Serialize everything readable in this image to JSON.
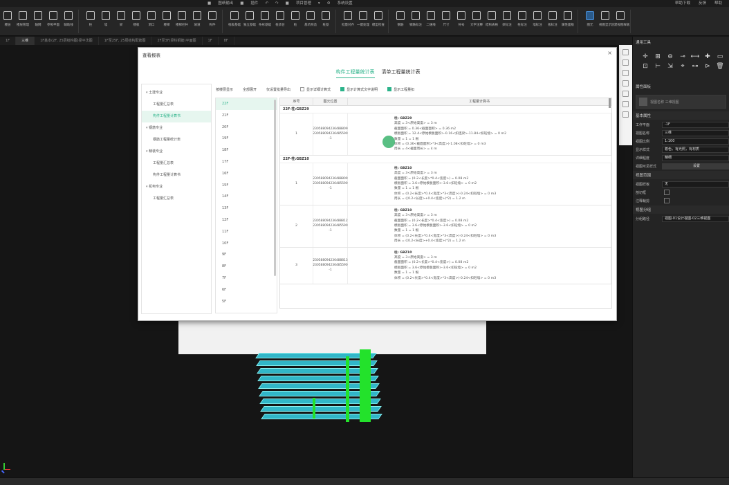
{
  "titlebar": {
    "menu": [
      "■",
      "图纸输出",
      "■",
      "插件",
      "↶",
      "↷",
      "■",
      "项目管理",
      "▾",
      "⚙",
      "系统设置"
    ],
    "right": [
      "帮助下载",
      "反馈",
      "帮助"
    ]
  },
  "ribbon": {
    "groups": [
      [
        "楼层",
        "楼层管理",
        "轴网",
        "参照平面",
        "辅助线"
      ],
      [
        "柱",
        "墙",
        "梁",
        "楼板",
        "洞口",
        "楼梯",
        "楼梯栏杆",
        "坡道",
        "构件"
      ],
      [
        "筏板基础",
        "独立基础",
        "条形基础",
        "桩承台",
        "桩",
        "基坑构造",
        "桩基"
      ],
      [
        "批量对齐",
        "一键处理",
        "模型检查"
      ],
      [
        "钢筋",
        "钢筋标注",
        "二维线",
        "尺寸",
        "符号",
        "文字注释",
        "结构表格",
        "梁标注",
        "柱标注",
        "墙标注",
        "板标注",
        "属性面板"
      ],
      [
        "图元",
        "视图显示",
        "创建视图样板"
      ]
    ]
  },
  "doctabs": [
    "1F",
    "三维",
    "1F基本(2F, 25层结构图)梁平法图",
    "1F至25F, 25层结构配筋图",
    "2F至3F(梁柱钢筋)平面图",
    "1F",
    "8F"
  ],
  "dialog": {
    "title": "查看报表",
    "close": "×",
    "tabs": [
      "构件工程量统计表",
      "清单工程量统计表"
    ],
    "tree": [
      {
        "label": "土建专业",
        "level": 0
      },
      {
        "label": "工程量汇总表",
        "level": 1
      },
      {
        "label": "构件工程量计算书",
        "level": 1,
        "selected": true
      },
      {
        "label": "钢筋专业",
        "level": 0
      },
      {
        "label": "钢筋工程量统计表",
        "level": 1
      },
      {
        "label": "精装专业",
        "level": 0
      },
      {
        "label": "工程量汇总表",
        "level": 1
      },
      {
        "label": "构件工程量计算书",
        "level": 1
      },
      {
        "label": "机电专业",
        "level": 0
      },
      {
        "label": "工程量汇总表",
        "level": 1
      }
    ],
    "toolbar": {
      "layer_display": "按楼层显示",
      "expand_all": "全部展开",
      "export": "仅设置批量导出",
      "show_detail": "显示详细计算式",
      "show_formula_text": "显示计算式文字说明",
      "show_qty_unit": "显示工程量扣"
    },
    "floors": [
      "22F",
      "21F",
      "20F",
      "19F",
      "18F",
      "17F",
      "16F",
      "15F",
      "14F",
      "13F",
      "12F",
      "11F",
      "10F",
      "9F",
      "8F",
      "7F",
      "6F",
      "5F"
    ],
    "table": {
      "headers": [
        "序号",
        "图元位置",
        "工程量计算书"
      ],
      "groups": [
        {
          "title": "22F-柱:GBZ29",
          "rows": [
            {
              "idx": "1",
              "pos": [
                "230588094236488809",
                "230588094236485590",
                "-1"
              ],
              "calc": [
                "柱: GBZ29",
                "高度 = 3<原始高度> = 3 m",
                "截面面积 = 0.36<截面面积> = 0.36 m2",
                "模板面积 = 12.4<原始模板面积>-0.16<扣连梁>-11.84<扣砼墙> = 0 m2",
                "数量 = 1 = 1 根",
                "体积 = (0.36<截面面积>*3<高度>)-1.08<扣砼墙> = 0 m3",
                "周长 = 4<截面周长> = 4 m"
              ]
            }
          ]
        },
        {
          "title": "22F-柱:GBZ10",
          "rows": [
            {
              "idx": "1",
              "pos": [
                "230588094236488809",
                "230588094236485590",
                "-1"
              ],
              "calc": [
                "柱: GBZ10",
                "高度 = 3<原始高度> = 3 m",
                "截面面积 = (0.2<长度>*0.4<宽度>) = 0.08 m2",
                "模板面积 = 3.6<原始模板面积>-3.6<扣砼墙> = 0 m2",
                "数量 = 1 = 1 根",
                "体积 = (0.2<长度>*0.4<宽度>*3<高度>)-0.24<扣砼墙> = 0 m3",
                "周长 = ((0.2<长度>+0.4<宽度>)*2) = 1.2 m"
              ]
            },
            {
              "idx": "2",
              "pos": [
                "230588094236488812",
                "230588094236485590",
                "-1"
              ],
              "calc": [
                "柱: GBZ10",
                "高度 = 3<原始高度> = 3 m",
                "截面面积 = (0.2<长度>*0.4<宽度>) = 0.08 m2",
                "模板面积 = 3.6<原始模板面积>-3.6<扣砼墙> = 0 m2",
                "数量 = 1 = 1 根",
                "体积 = (0.2<长度>*0.4<宽度>*3<高度>)-0.24<扣砼墙> = 0 m3",
                "周长 = ((0.2<长度>+0.4<宽度>)*2) = 1.2 m"
              ]
            },
            {
              "idx": "3",
              "pos": [
                "230588094236488813",
                "230588094236485590",
                "-1"
              ],
              "calc": [
                "柱: GBZ10",
                "高度 = 3<原始高度> = 3 m",
                "截面面积 = (0.2<长度>*0.4<宽度>) = 0.08 m2",
                "模板面积 = 3.6<原始模板面积>-3.6<扣砼墙> = 0 m2",
                "数量 = 1 = 1 根",
                "体积 = (0.2<长度>*0.4<宽度>*3<高度>)-0.24<扣砼墙> = 0 m3"
              ]
            }
          ]
        }
      ]
    }
  },
  "rightpanel": {
    "title": "通用工具",
    "tools": [
      "✛",
      "⊞",
      "⊖",
      "⊸",
      "⟷",
      "✚",
      "▭",
      "⊡",
      "⊢",
      "⇲",
      "⌖",
      "⊶",
      "⊳",
      "🗑"
    ],
    "props_title": "属性面板",
    "preview_label": "视图名称 三维视图",
    "section_basic": "基本属性",
    "props": [
      {
        "k": "工作平面",
        "v": "-1F"
      },
      {
        "k": "视图名称",
        "v": "三维"
      },
      {
        "k": "视图比例",
        "v": "1:100"
      },
      {
        "k": "显示样式",
        "v": "着色，有光照，有材质"
      },
      {
        "k": "详细程度",
        "v": "精细"
      },
      {
        "k": "视图可见样式",
        "v": "设置"
      }
    ],
    "section_range": "视图范围",
    "props2": [
      {
        "k": "视图样板",
        "v": "无"
      },
      {
        "k": "剖切框",
        "v": ""
      },
      {
        "k": "注释裁剪",
        "v": ""
      }
    ],
    "section_split": "视图分组",
    "props3": [
      {
        "k": "分组路径",
        "v": "视图-01设计视图-02三维视图"
      }
    ]
  }
}
